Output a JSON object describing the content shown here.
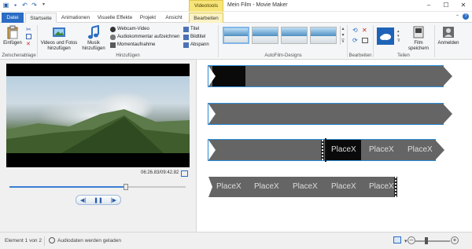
{
  "window": {
    "title": "Mein Film - Movie Maker",
    "context_tab": "Videotools"
  },
  "tabs": [
    "Datei",
    "Startseite",
    "Animationen",
    "Visuelle Effekte",
    "Projekt",
    "Ansicht",
    "Bearbeiten"
  ],
  "ribbon": {
    "clipboard": {
      "paste": "Einfügen",
      "label": "Zwischenablage"
    },
    "add": {
      "videos_photos_1": "Videos und Fotos",
      "videos_photos_2": "hinzufügen",
      "music_1": "Musik",
      "music_2": "hinzufügen",
      "webcam": "Webcam-Video",
      "audio_comment": "Audiokommentar aufzeichnen",
      "snapshot": "Momentaufnahme",
      "title": "Titel",
      "caption": "Bildtitel",
      "credits": "Abspann",
      "label": "Hinzufügen"
    },
    "themes": {
      "label": "AutoFilm-Designs"
    },
    "edit": {
      "label": "Bearbeiten"
    },
    "share": {
      "save_1": "Film",
      "save_2": "speichern",
      "label": "Teilen"
    },
    "signin": "Anmelden"
  },
  "player": {
    "timecode": "06:26.83/09:42.82",
    "progress": 0.66
  },
  "storyboard": {
    "placeholder": "PlaceX"
  },
  "status": {
    "item": "Element 1 von 2",
    "audio": "Audiodaten werden geladen"
  },
  "colors": {
    "accent": "#2b6cc4",
    "strip": "#656565",
    "context": "#f7e57a"
  }
}
